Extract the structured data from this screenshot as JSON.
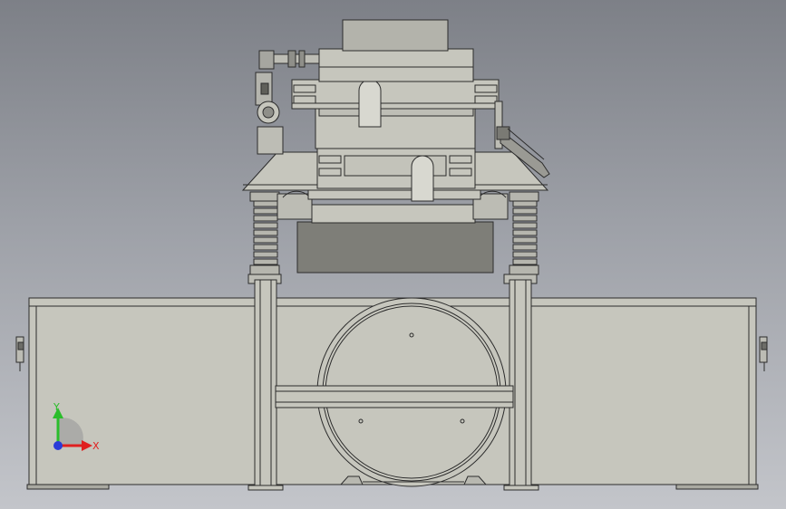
{
  "view": {
    "background_top": "#7d8087",
    "background_bottom": "#c3c5ca",
    "part_color": "#c6c6bd",
    "dark_part_color": "#7e7e78",
    "edge_color": "#2c2c2c"
  },
  "triad": {
    "x_label": "X",
    "y_label": "Y",
    "x_color": "#e02020",
    "y_color": "#2bbd2b",
    "z_color": "#2a3bd8"
  }
}
